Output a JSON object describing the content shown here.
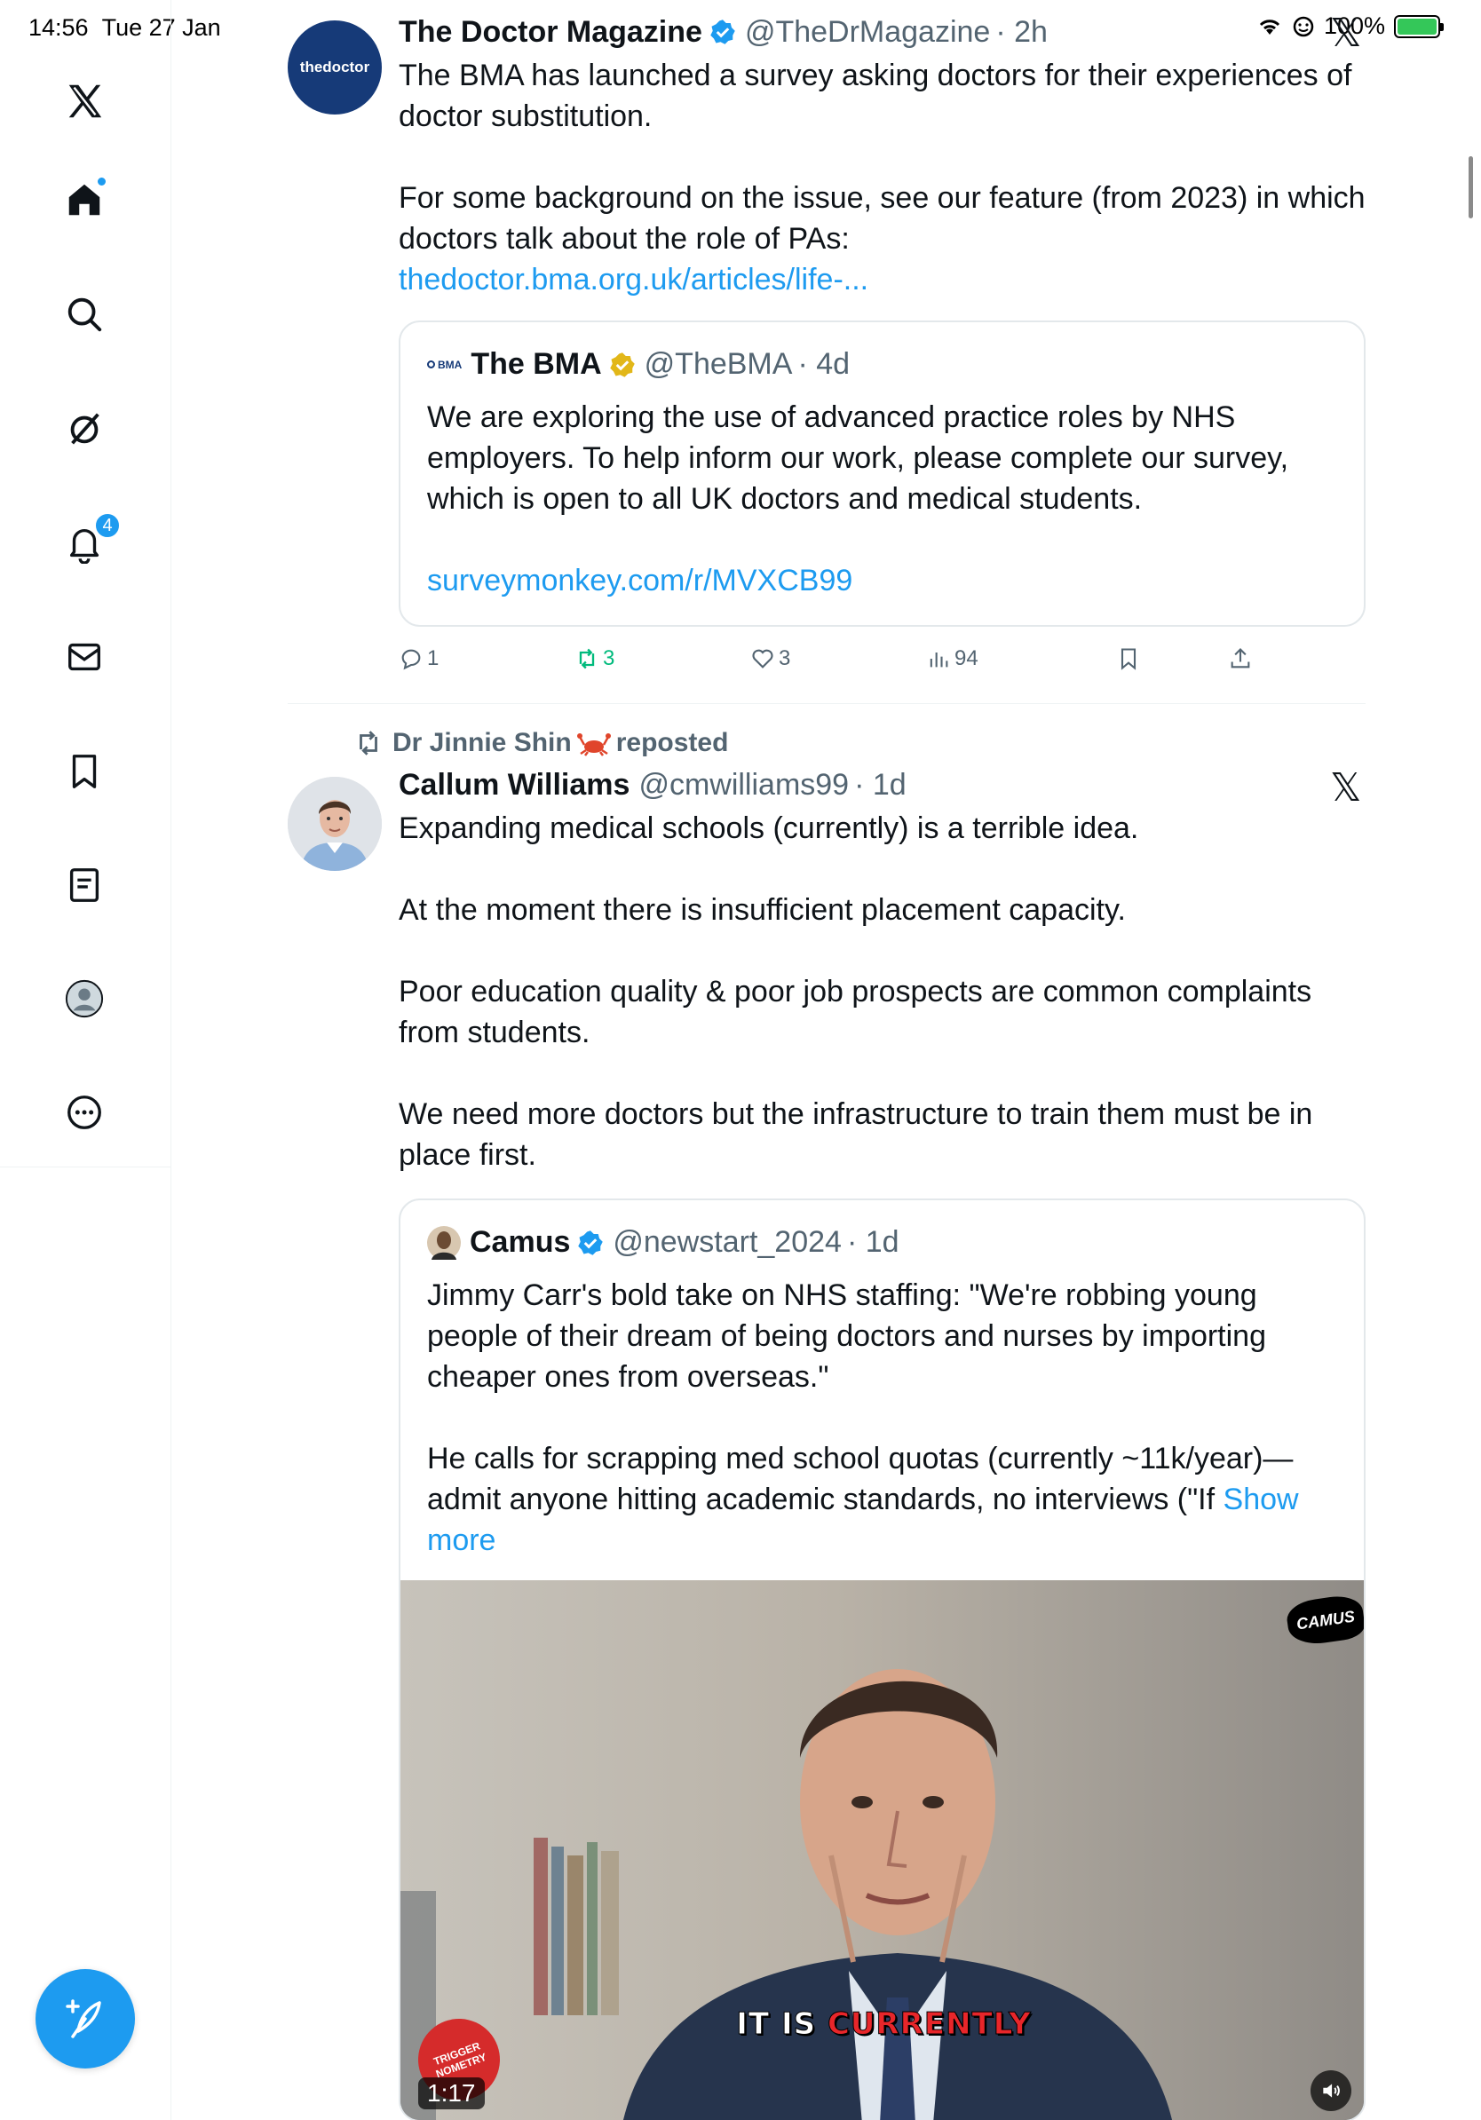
{
  "status_bar": {
    "time": "14:56",
    "date": "Tue 27 Jan",
    "battery": "100%"
  },
  "sidebar": {
    "notifications_badge": "4",
    "items": [
      "x-logo",
      "home",
      "search",
      "grok",
      "notifications",
      "messages",
      "bookmarks",
      "lists",
      "profile",
      "more"
    ]
  },
  "tweet1": {
    "author": "The Doctor Magazine",
    "handle": "@TheDrMagazine",
    "time": "· 2h",
    "avatar_text": "thedoctor",
    "text": "The BMA has launched a survey asking doctors for their experiences of doctor substitution.\n\nFor some background on the issue, see our feature (from 2023) in which doctors talk about the role of PAs:",
    "link": "thedoctor.bma.org.uk/articles/life-...",
    "quote": {
      "logo": "BMA",
      "author": "The BMA",
      "handle": "@TheBMA",
      "time": "· 4d",
      "text": "We are exploring the use of advanced practice roles by NHS employers. To help inform our work, please complete our survey, which is open to all UK doctors and medical students.",
      "link": "surveymonkey.com/r/MVXCB99"
    },
    "replies": "1",
    "reposts": "3",
    "likes": "3",
    "views": "94"
  },
  "tweet2": {
    "repost_label": "Dr Jinnie Shin",
    "repost_suffix": "reposted",
    "author": "Callum Williams",
    "handle": "@cmwilliams99",
    "time": "· 1d",
    "text": "Expanding medical schools (currently) is a terrible idea.\n\nAt the moment there is insufficient placement capacity.\n\nPoor education quality & poor job prospects are common complaints from students.\n\nWe need more doctors but the infrastructure to train them must be in place first.",
    "quote": {
      "author": "Camus",
      "handle": "@newstart_2024",
      "time": "· 1d",
      "text": "Jimmy Carr's bold take on NHS staffing: \"We're robbing young people of their dream of being doctors and nurses by importing cheaper ones from overseas.\"\n\nHe calls for scrapping med school quotas (currently ~11k/year)—admit anyone hitting academic standards, no interviews (\"If",
      "show_more": "Show more",
      "video": {
        "caption_white": "IT IS",
        "caption_red": "CURRENTLY",
        "duration": "1:17",
        "watermark": "CAMUS",
        "channel_logo": "TRIGGER NOMETRY"
      }
    }
  },
  "colors": {
    "accent": "#1d9bf0",
    "repost_green": "#00ba7c",
    "text_secondary": "#536471"
  }
}
